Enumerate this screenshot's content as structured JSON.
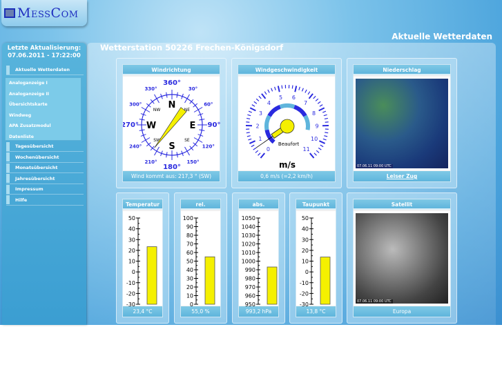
{
  "logo": {
    "text": "MessCom"
  },
  "header": {
    "title": "Aktuelle Wetterdaten"
  },
  "station": {
    "title": "Wetterstation 50226 Frechen-Königsdorf"
  },
  "sidebar": {
    "last_update_label": "Letzte Aktualisierung:",
    "last_update": "07.06.2011 - 17:22:00",
    "active": "Aktuelle Wetterdaten",
    "sub_items": [
      "Analoganzeige I",
      "Analoganzeige II",
      "Übersichtskarte",
      "Windweg",
      "APA Zusatzmodul",
      "Datenliste"
    ],
    "items": [
      "Tagesübersicht",
      "Wochenübersicht",
      "Monatsübersicht",
      "Jahresübersicht",
      "Impressum",
      "Hilfe"
    ]
  },
  "wind_direction": {
    "title": "Windrichtung",
    "degrees": 217.3,
    "footer": "Wind kommt aus: 217,3 ° (SW)",
    "cardinals": [
      "N",
      "E",
      "S",
      "W"
    ],
    "intercardinals": [
      "NE",
      "SE",
      "SW",
      "NW"
    ],
    "degree_labels": [
      "360°",
      "30°",
      "60°",
      "90°",
      "120°",
      "150°",
      "180°",
      "210°",
      "240°",
      "270°",
      "300°",
      "330°"
    ]
  },
  "wind_speed": {
    "title": "Windgeschwindigkeit",
    "value_ms": 0.6,
    "footer": "0,6 m/s (=2,2 km/h)",
    "unit": "m/s",
    "scale_label": "Beaufort",
    "ms_labels": [
      "0",
      "1",
      "2",
      "3",
      "4",
      "5",
      "6",
      "7",
      "8",
      "9",
      "10",
      "11"
    ],
    "bft_labels": [
      "1",
      "2",
      "3",
      "4",
      "5",
      "6"
    ]
  },
  "precipitation": {
    "title": "Niederschlag",
    "footer": "Leiser Zug",
    "timestamp": "07.06.11 09:00 UTC"
  },
  "satellite": {
    "title": "Satellit",
    "footer": "Europa",
    "timestamp": "07.06.11 09:00 UTC"
  },
  "gauges": [
    {
      "title": "Temperatur",
      "value": 23.4,
      "min": -30,
      "max": 50,
      "step": 10,
      "footer": "23,4 °C"
    },
    {
      "title": "rel. Luftfeuchte",
      "value": 55.0,
      "min": 0,
      "max": 100,
      "step": 10,
      "footer": "55,0 %"
    },
    {
      "title": "abs. Luftdruck",
      "value": 993.2,
      "min": 950,
      "max": 1050,
      "step": 10,
      "footer": "993,2 hPa"
    },
    {
      "title": "Taupunkt",
      "value": 13.8,
      "min": -30,
      "max": 50,
      "step": 10,
      "footer": "13,8 °C"
    }
  ],
  "colors": {
    "bar": "#f5f000",
    "scale": "#2a2adf",
    "panel": "#6cc0e2"
  }
}
